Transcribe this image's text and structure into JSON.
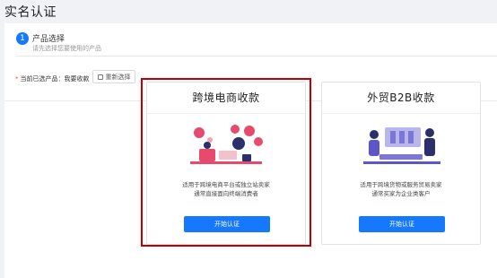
{
  "page": {
    "title": "实名认证"
  },
  "step": {
    "number": "1",
    "title": "产品选择",
    "description": "请先选择您要使用的产品"
  },
  "selection": {
    "label": "当前已选产品：我要收款",
    "reset_label": "重新选择"
  },
  "products": [
    {
      "title": "跨境电商收款",
      "desc_line1": "适用于跨境电商平台或独立站卖家",
      "desc_line2": "通常直接面向终端消费者",
      "button_label": "开始认证"
    },
    {
      "title": "外贸B2B收款",
      "desc_line1": "适用于跨境货物或服务贸易卖家",
      "desc_line2": "通常买家为企业类客户",
      "button_label": "开始认证"
    }
  ],
  "colors": {
    "primary": "#1677ff",
    "highlight_border": "#c00000",
    "illustration_pink": "#e84a6d",
    "illustration_navy": "#2b2f6b"
  }
}
